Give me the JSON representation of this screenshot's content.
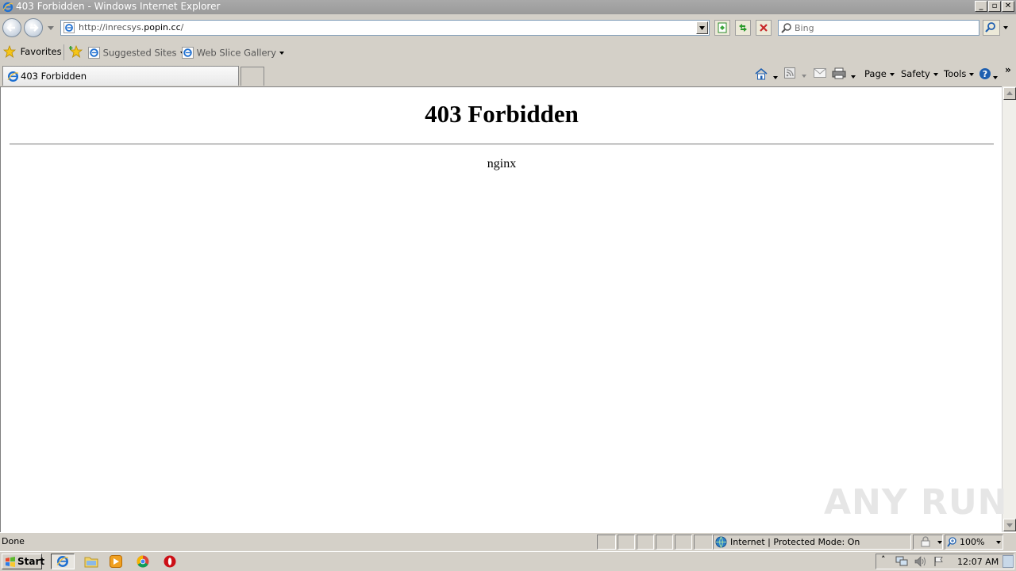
{
  "window": {
    "title": "403 Forbidden - Windows Internet Explorer"
  },
  "navigation": {
    "address": {
      "prefix": "http://inrecsys.",
      "domain": "popin.cc",
      "suffix": "/"
    },
    "search": {
      "placeholder": "Bing"
    }
  },
  "favorites_bar": {
    "favorites_label": "Favorites",
    "items": [
      {
        "label": "Suggested Sites"
      },
      {
        "label": "Web Slice Gallery"
      }
    ]
  },
  "tabs": [
    {
      "label": "403 Forbidden"
    }
  ],
  "command_bar": {
    "page": "Page",
    "safety": "Safety",
    "tools": "Tools"
  },
  "page": {
    "heading": "403 Forbidden",
    "server": "nginx"
  },
  "watermark": "ANY RUN",
  "status_bar": {
    "status": "Done",
    "zone": "Internet | Protected Mode: On",
    "zoom": "100%"
  },
  "taskbar": {
    "start_label": "Start",
    "clock": "12:07 AM"
  },
  "colors": {
    "title_bar": "#a9a9a9",
    "chrome": "#d4d0c8",
    "ie_blue": "#1e6fd0"
  }
}
